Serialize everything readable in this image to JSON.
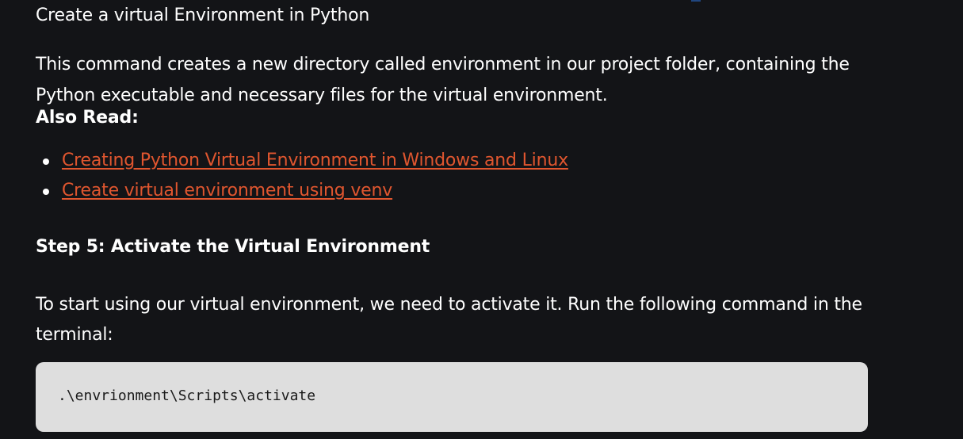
{
  "article": {
    "image_caption": "Create a virtual Environment in Python",
    "paragraph_1": "This command creates a new directory called environment in our project folder, containing the Python executable and necessary files for the virtual environment.",
    "also_read_label": "Also Read:",
    "related_links": [
      {
        "label": "Creating Python Virtual Environment in Windows and Linux"
      },
      {
        "label": "Create virtual environment using venv"
      }
    ],
    "step_heading": "Step 5: Activate the Virtual Environment",
    "paragraph_2": "To start using our virtual environment, we need to activate it. Run the following command in the terminal:",
    "code": ".\\envrionment\\Scripts\\activate"
  },
  "colors": {
    "background": "#131417",
    "text": "#ffffff",
    "link": "#e0562f",
    "code_background": "#dedede",
    "code_text": "#1a1a1a"
  }
}
